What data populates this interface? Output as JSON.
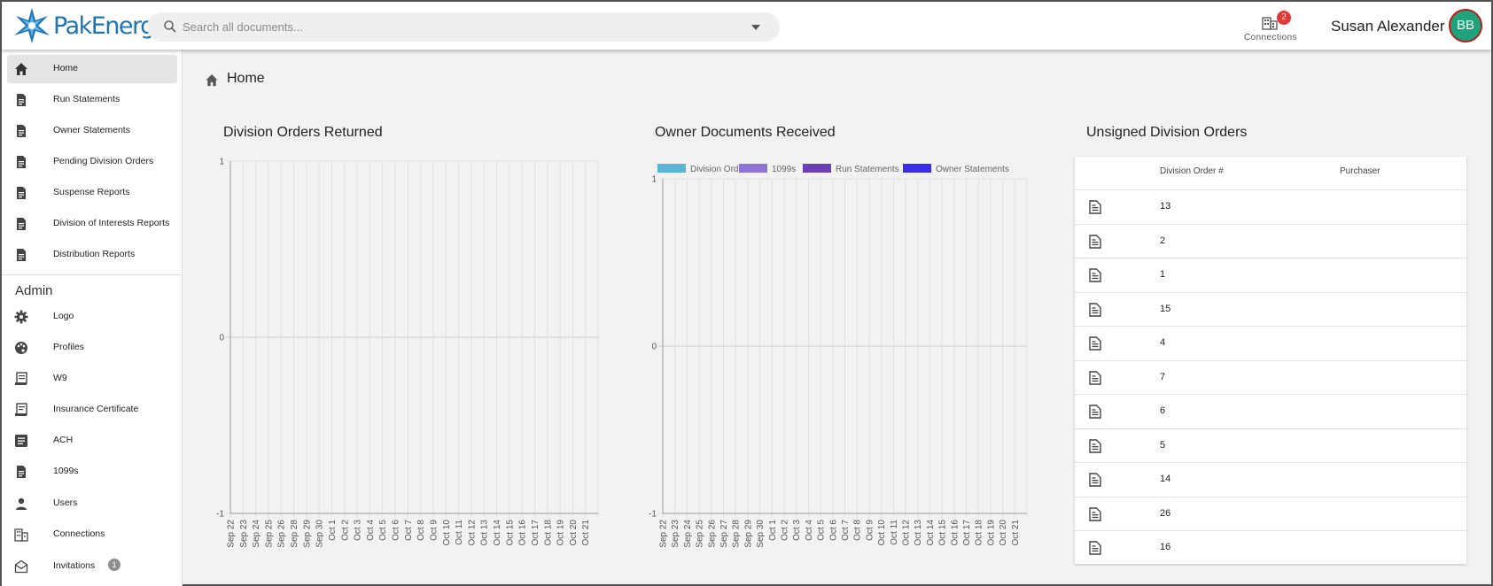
{
  "header": {
    "logo_text": "PakEnergy",
    "search_placeholder": "Search all documents...",
    "connections_label": "Connections",
    "connections_badge": "2",
    "user_name": "Susan Alexander",
    "avatar_initials": "BB"
  },
  "sidebar": {
    "items": [
      {
        "label": "Home",
        "icon": "home-icon",
        "active": true
      },
      {
        "label": "Run Statements",
        "icon": "document-icon"
      },
      {
        "label": "Owner Statements",
        "icon": "document-icon"
      },
      {
        "label": "Pending Division Orders",
        "icon": "document-icon"
      },
      {
        "label": "Suspense Reports",
        "icon": "document-icon"
      },
      {
        "label": "Division of Interests Reports",
        "icon": "document-icon"
      },
      {
        "label": "Distribution Reports",
        "icon": "document-icon"
      }
    ],
    "admin_heading": "Admin",
    "admin_items": [
      {
        "label": "Logo",
        "icon": "gear-icon"
      },
      {
        "label": "Profiles",
        "icon": "palette-icon"
      },
      {
        "label": "W9",
        "icon": "receipt-icon"
      },
      {
        "label": "Insurance Certificate",
        "icon": "certificate-icon"
      },
      {
        "label": "ACH",
        "icon": "list-icon"
      },
      {
        "label": "1099s",
        "icon": "document-icon"
      },
      {
        "label": "Users",
        "icon": "person-icon"
      },
      {
        "label": "Connections",
        "icon": "building-icon"
      },
      {
        "label": "Invitations",
        "icon": "mail-icon",
        "badge": "1"
      }
    ]
  },
  "main": {
    "breadcrumb": "Home",
    "panels": {
      "division_orders_returned": "Division Orders Returned",
      "owner_documents_received": "Owner Documents Received",
      "unsigned_division_orders": "Unsigned Division Orders"
    }
  },
  "chart_data": [
    {
      "type": "line",
      "title": "Division Orders Returned",
      "x": [
        "Sep 22",
        "Sep 23",
        "Sep 24",
        "Sep 25",
        "Sep 26",
        "Sep 28",
        "Sep 29",
        "Sep 30",
        "Oct 1",
        "Oct 2",
        "Oct 3",
        "Oct 4",
        "Oct 5",
        "Oct 6",
        "Oct 7",
        "Oct 8",
        "Oct 9",
        "Oct 10",
        "Oct 11",
        "Oct 12",
        "Oct 13",
        "Oct 14",
        "Oct 15",
        "Oct 16",
        "Oct 17",
        "Oct 18",
        "Oct 19",
        "Oct 20",
        "Oct 21"
      ],
      "yticks": [
        "1",
        "0",
        "-1"
      ],
      "ylim": [
        -1,
        1
      ],
      "series": [],
      "grid": true
    },
    {
      "type": "bar",
      "title": "Owner Documents Received",
      "x": [
        "Sep 22",
        "Sep 23",
        "Sep 24",
        "Sep 25",
        "Sep 26",
        "Sep 27",
        "Sep 28",
        "Sep 29",
        "Sep 30",
        "Oct 1",
        "Oct 2",
        "Oct 3",
        "Oct 4",
        "Oct 5",
        "Oct 6",
        "Oct 7",
        "Oct 8",
        "Oct 9",
        "Oct 10",
        "Oct 11",
        "Oct 12",
        "Oct 13",
        "Oct 14",
        "Oct 15",
        "Oct 16",
        "Oct 17",
        "Oct 18",
        "Oct 19",
        "Oct 20",
        "Oct 21"
      ],
      "yticks": [
        "1",
        "0",
        "-1"
      ],
      "ylim": [
        -1,
        1
      ],
      "series": [
        {
          "name": "Division Orders",
          "color": "#5ab4d6",
          "values": []
        },
        {
          "name": "1099s",
          "color": "#8f74d8",
          "values": []
        },
        {
          "name": "Run Statements",
          "color": "#6a3fb5",
          "values": []
        },
        {
          "name": "Owner Statements",
          "color": "#3a2de8",
          "values": []
        }
      ],
      "legend": "top-left",
      "grid": true
    }
  ],
  "unsigned_table": {
    "columns": [
      "Division Order #",
      "Purchaser"
    ],
    "rows": [
      "13",
      "2",
      "1",
      "15",
      "4",
      "7",
      "6",
      "5",
      "14",
      "26",
      "16"
    ]
  }
}
